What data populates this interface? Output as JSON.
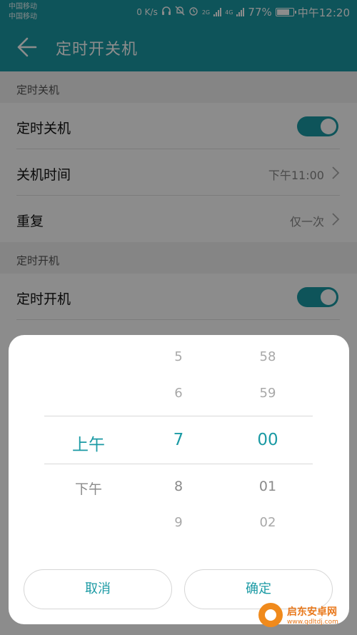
{
  "status_bar": {
    "carrier_1": "中国移动",
    "carrier_2": "中国移动",
    "net_speed": "0 K/s",
    "net_2g": "2G",
    "net_4g": "4G",
    "battery": "77%",
    "time": "中午12:20"
  },
  "header": {
    "title": "定时开关机",
    "back_icon": "arrow-left-icon"
  },
  "shutdown_section": {
    "header": "定时关机",
    "toggle_label": "定时关机",
    "toggle_on": true,
    "time_label": "关机时间",
    "time_value": "下午11:00",
    "repeat_label": "重复",
    "repeat_value": "仅一次"
  },
  "boot_section": {
    "header": "定时开机",
    "toggle_label": "定时开机",
    "toggle_on": true
  },
  "time_picker": {
    "ampm": {
      "selected": "上午",
      "below": "下午"
    },
    "hours": {
      "above_2": "5",
      "above_1": "6",
      "selected": "7",
      "below_1": "8",
      "below_2": "9"
    },
    "minutes": {
      "above_2": "58",
      "above_1": "59",
      "selected": "00",
      "below_1": "01",
      "below_2": "02"
    },
    "cancel_label": "取消",
    "confirm_label": "确定"
  },
  "watermark": {
    "name": "启东安卓网",
    "url": "www.qdltdj.com"
  },
  "colors": {
    "accent": "#1b9aa4",
    "overlay": "rgba(0,0,0,0.45)",
    "watermark": "#e9781b"
  }
}
